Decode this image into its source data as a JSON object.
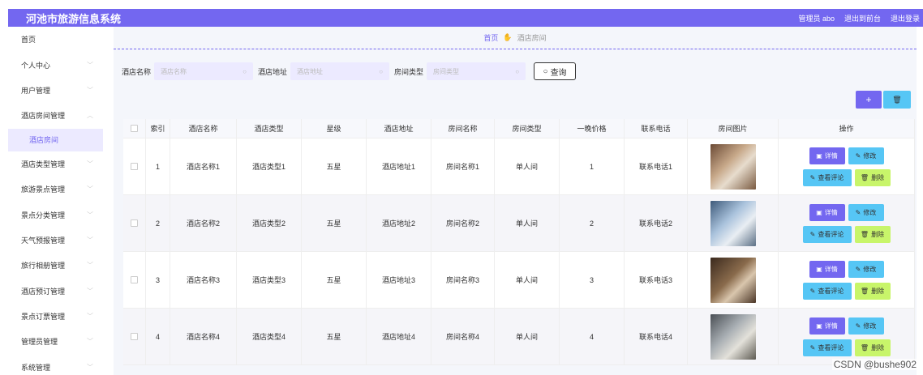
{
  "topbar": {
    "title": "河池市旅游信息系统",
    "admin": "管理员 abo",
    "front": "退出到前台",
    "logout": "退出登录"
  },
  "sidebar": {
    "items": [
      {
        "label": "首页",
        "chevron": false
      },
      {
        "label": "个人中心",
        "chevron": true
      },
      {
        "label": "用户管理",
        "chevron": true
      },
      {
        "label": "酒店房间管理",
        "chevron": true,
        "open": true
      },
      {
        "label": "酒店类型管理",
        "chevron": true
      },
      {
        "label": "旅游景点管理",
        "chevron": true
      },
      {
        "label": "景点分类管理",
        "chevron": true
      },
      {
        "label": "天气预报管理",
        "chevron": true
      },
      {
        "label": "旅行相册管理",
        "chevron": true
      },
      {
        "label": "酒店预订管理",
        "chevron": true
      },
      {
        "label": "景点订票管理",
        "chevron": true
      },
      {
        "label": "管理员管理",
        "chevron": true
      },
      {
        "label": "系统管理",
        "chevron": true
      }
    ],
    "submenu": "酒店房间"
  },
  "breadcrumb": {
    "home": "首页",
    "current": "酒店房间"
  },
  "search": {
    "hotel_name_label": "酒店名称",
    "hotel_name_placeholder": "酒店名称",
    "hotel_addr_label": "酒店地址",
    "hotel_addr_placeholder": "酒店地址",
    "room_type_label": "房间类型",
    "room_type_placeholder": "房间类型",
    "query": "查询"
  },
  "actions": {
    "add": "+",
    "delete": "🗑"
  },
  "table": {
    "headers": [
      "索引",
      "酒店名称",
      "酒店类型",
      "星级",
      "酒店地址",
      "房间名称",
      "房间类型",
      "一晚价格",
      "联系电话",
      "房间图片",
      "操作"
    ],
    "rows": [
      {
        "idx": "1",
        "name": "酒店名称1",
        "type": "酒店类型1",
        "star": "五星",
        "addr": "酒店地址1",
        "room": "房间名称1",
        "rtype": "单人间",
        "price": "1",
        "phone": "联系电话1"
      },
      {
        "idx": "2",
        "name": "酒店名称2",
        "type": "酒店类型2",
        "star": "五星",
        "addr": "酒店地址2",
        "room": "房间名称2",
        "rtype": "单人间",
        "price": "2",
        "phone": "联系电话2"
      },
      {
        "idx": "3",
        "name": "酒店名称3",
        "type": "酒店类型3",
        "star": "五星",
        "addr": "酒店地址3",
        "room": "房间名称3",
        "rtype": "单人间",
        "price": "3",
        "phone": "联系电话3"
      },
      {
        "idx": "4",
        "name": "酒店名称4",
        "type": "酒店类型4",
        "star": "五星",
        "addr": "酒店地址4",
        "room": "房间名称4",
        "rtype": "单人间",
        "price": "4",
        "phone": "联系电话4"
      }
    ],
    "ops": {
      "detail": "详情",
      "edit": "修改",
      "review": "查看评论",
      "del": "删除"
    }
  },
  "watermark": "CSDN @bushe902"
}
